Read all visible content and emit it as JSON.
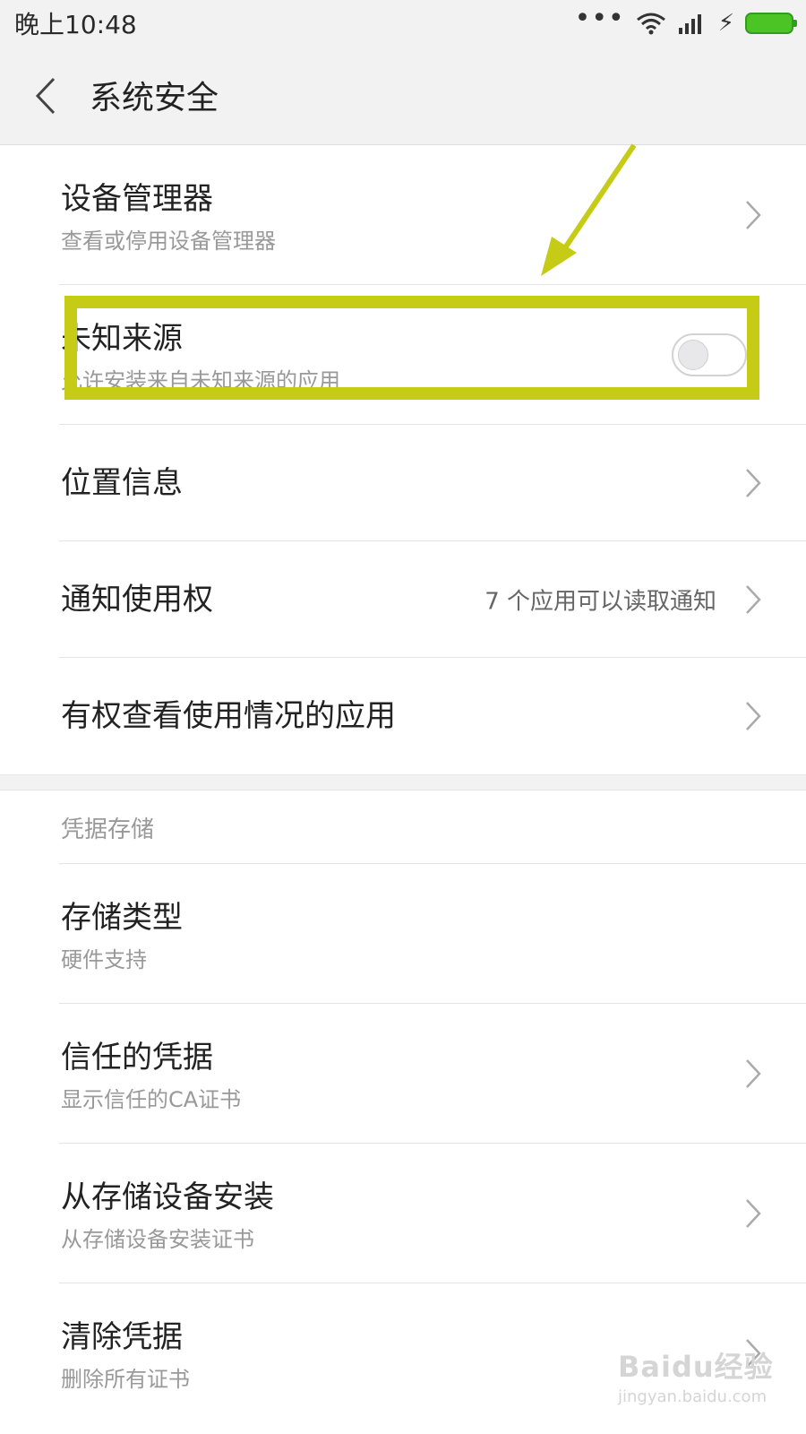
{
  "status_bar": {
    "time": "晚上10:48",
    "more_dots": "•••"
  },
  "header": {
    "title": "系统安全"
  },
  "list_items": [
    {
      "label": "设备管理器",
      "sub": "查看或停用设备管理器"
    },
    {
      "label": "未知来源",
      "sub": "允许安装来自未知来源的应用",
      "toggle_on": false
    },
    {
      "label": "位置信息"
    },
    {
      "label": "通知使用权",
      "value": "7 个应用可以读取通知"
    },
    {
      "label": "有权查看使用情况的应用"
    }
  ],
  "credential_section": {
    "header": "凭据存储",
    "items": [
      {
        "label": "存储类型",
        "sub": "硬件支持"
      },
      {
        "label": "信任的凭据",
        "sub": "显示信任的CA证书"
      },
      {
        "label": "从存储设备安装",
        "sub": "从存储设备安装证书"
      },
      {
        "label": "清除凭据",
        "sub": "删除所有证书"
      }
    ]
  },
  "watermark": {
    "brand": "Baidu经验",
    "url": "jingyan.baidu.com"
  },
  "colors": {
    "highlight": "#c6cc16",
    "battery": "#4cc425",
    "background": "#ffffff",
    "bar": "#f2f2f2"
  }
}
